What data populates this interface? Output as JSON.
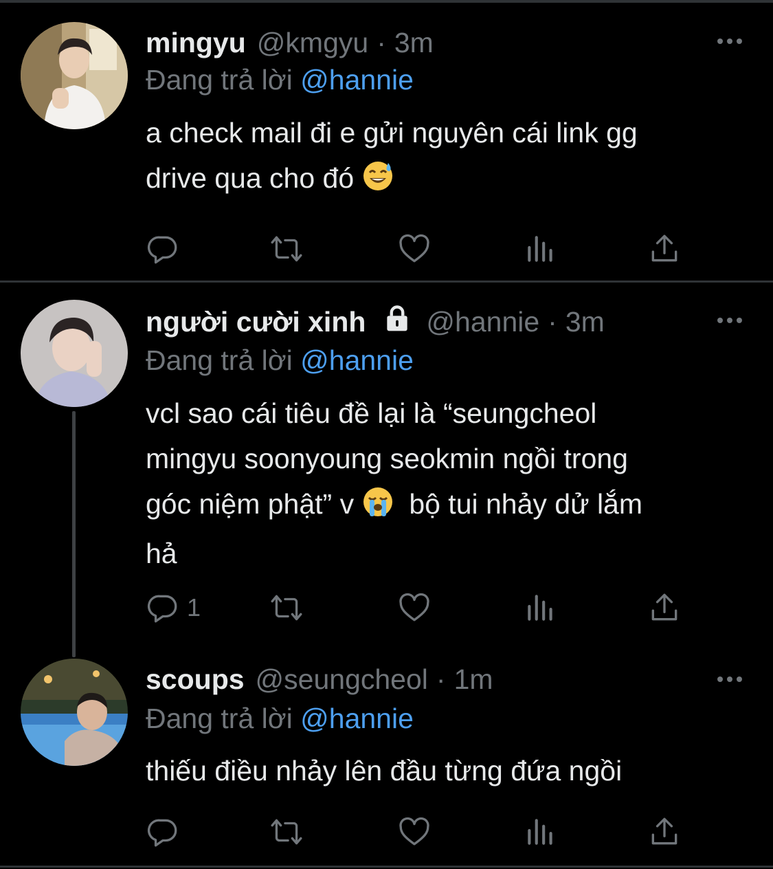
{
  "tweets": [
    {
      "name": "mingyu",
      "handle": "@kmgyu",
      "separator": "·",
      "time": "3m",
      "reply_prefix": "Đang trả lời",
      "reply_mention": "@hannie",
      "text_lines": [
        "a check mail đi e gửi nguyên cái link gg",
        "drive qua cho đó"
      ],
      "emoji_names": [
        "grinning-sweat-emoji"
      ],
      "locked": false,
      "reply_count": ""
    },
    {
      "name": "người cười xinh",
      "handle": "@hannie",
      "separator": "·",
      "time": "3m",
      "reply_prefix": "Đang trả lời",
      "reply_mention": "@hannie",
      "text_lines": [
        "vcl sao cái tiêu đề lại là “seungcheol",
        "mingyu soonyoung seokmin ngồi trong",
        "góc niệm phật” v",
        "bộ tui nhảy dử lắm",
        "hả"
      ],
      "emoji_names": [
        "loudly-crying-emoji"
      ],
      "locked": true,
      "reply_count": "1"
    },
    {
      "name": "scoups",
      "handle": "@seungcheol",
      "separator": "·",
      "time": "1m",
      "reply_prefix": "Đang trả lời",
      "reply_mention": "@hannie",
      "text_lines": [
        "thiếu điều nhảy lên đầu từng đứa ngồi"
      ],
      "emoji_names": [],
      "locked": false,
      "reply_count": ""
    }
  ],
  "icons": [
    "reply-icon",
    "retweet-icon",
    "like-icon",
    "analytics-icon",
    "share-icon",
    "more-icon",
    "lock-icon"
  ],
  "colors": {
    "background": "#000000",
    "text": "#e7e9ea",
    "muted": "#71767b",
    "mention": "#4d9ff0",
    "divider": "#2f3336"
  }
}
